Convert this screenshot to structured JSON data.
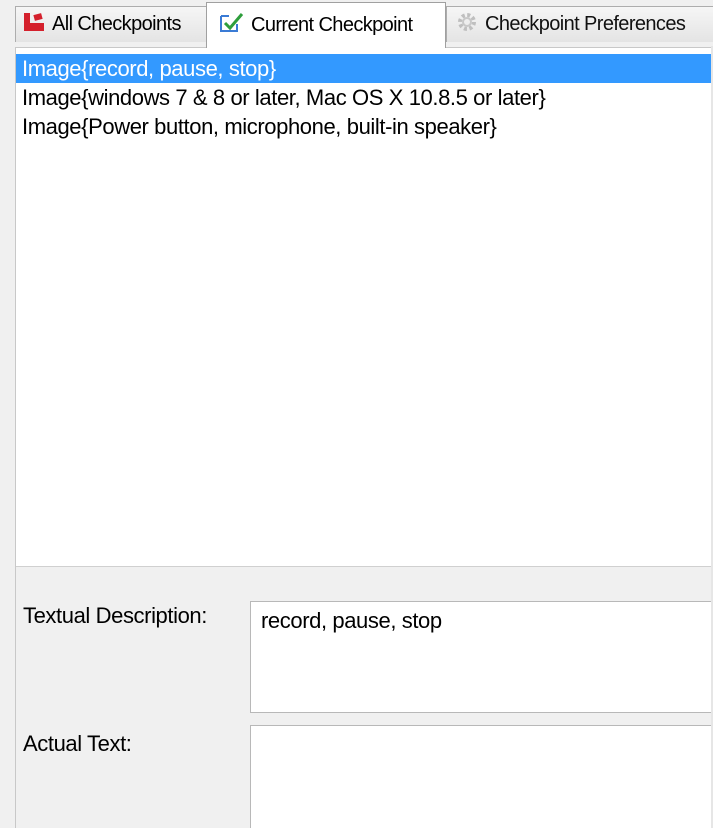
{
  "tabs": [
    {
      "label": "All Checkpoints",
      "icon": "checkpoints-flag-icon",
      "active": false
    },
    {
      "label": "Current Checkpoint",
      "icon": "checkbox-check-icon",
      "active": true
    },
    {
      "label": "Checkpoint Preferences",
      "icon": "gear-icon",
      "active": false
    }
  ],
  "list": {
    "items": [
      {
        "label": "Image{record, pause, stop}",
        "selected": true
      },
      {
        "label": "Image{windows 7 & 8 or later, Mac OS X 10.8.5 or later}",
        "selected": false
      },
      {
        "label": "Image{Power button, microphone, built-in speaker}",
        "selected": false
      }
    ]
  },
  "form": {
    "textual_description_label": "Textual Description:",
    "textual_description_value": "record, pause, stop",
    "actual_text_label": "Actual Text:",
    "actual_text_value": ""
  },
  "colors": {
    "selection": "#3399ff",
    "tab_icon_red": "#d4202c",
    "check_green": "#2e9e3c",
    "check_blue": "#3a7bd5"
  }
}
